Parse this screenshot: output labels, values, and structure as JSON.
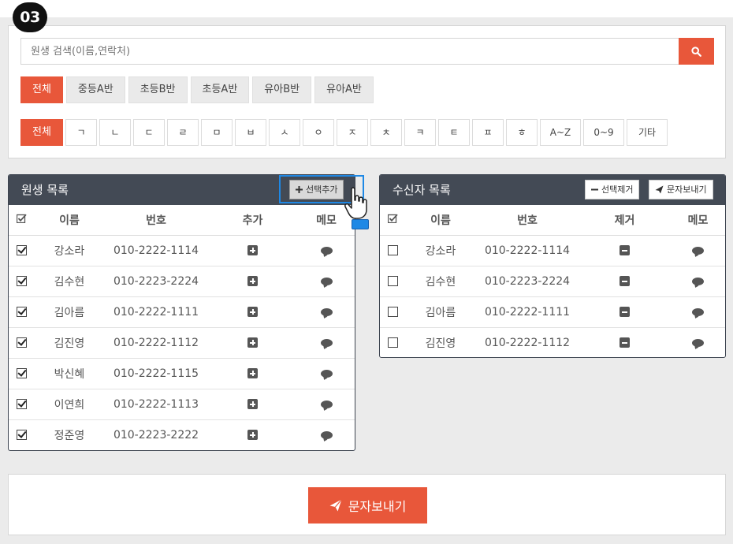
{
  "step": "03",
  "search": {
    "placeholder": "원생 검색(이름,연락처)"
  },
  "class_filters": [
    "전체",
    "중등A반",
    "초등B반",
    "초등A반",
    "유아B반",
    "유아A반"
  ],
  "initial_filters": [
    "전체",
    "ㄱ",
    "ㄴ",
    "ㄷ",
    "ㄹ",
    "ㅁ",
    "ㅂ",
    "ㅅ",
    "ㅇ",
    "ㅈ",
    "ㅊ",
    "ㅋ",
    "ㅌ",
    "ㅍ",
    "ㅎ",
    "A~Z",
    "0~9",
    "기타"
  ],
  "students": {
    "title": "원생 목록",
    "add_selected_label": "선택추가",
    "columns": {
      "name": "이름",
      "number": "번호",
      "add": "추가",
      "memo": "메모"
    },
    "rows": [
      {
        "name": "강소라",
        "number": "010-2222-1114"
      },
      {
        "name": "김수현",
        "number": "010-2223-2224"
      },
      {
        "name": "김아름",
        "number": "010-2222-1111"
      },
      {
        "name": "김진영",
        "number": "010-2222-1112"
      },
      {
        "name": "박신혜",
        "number": "010-2222-1115"
      },
      {
        "name": "이연희",
        "number": "010-2222-1113"
      },
      {
        "name": "정준영",
        "number": "010-2223-2222"
      }
    ]
  },
  "recipients": {
    "title": "수신자 목록",
    "remove_selected_label": "선택제거",
    "send_label": "문자보내기",
    "columns": {
      "name": "이름",
      "number": "번호",
      "remove": "제거",
      "memo": "메모"
    },
    "rows": [
      {
        "name": "강소라",
        "number": "010-2222-1114"
      },
      {
        "name": "김수현",
        "number": "010-2223-2224"
      },
      {
        "name": "김아름",
        "number": "010-2222-1111"
      },
      {
        "name": "김진영",
        "number": "010-2222-1112"
      }
    ]
  },
  "send_button_label": "문자보내기",
  "colors": {
    "accent": "#e8573a",
    "header": "#434a55",
    "highlight": "#1e88e5"
  }
}
